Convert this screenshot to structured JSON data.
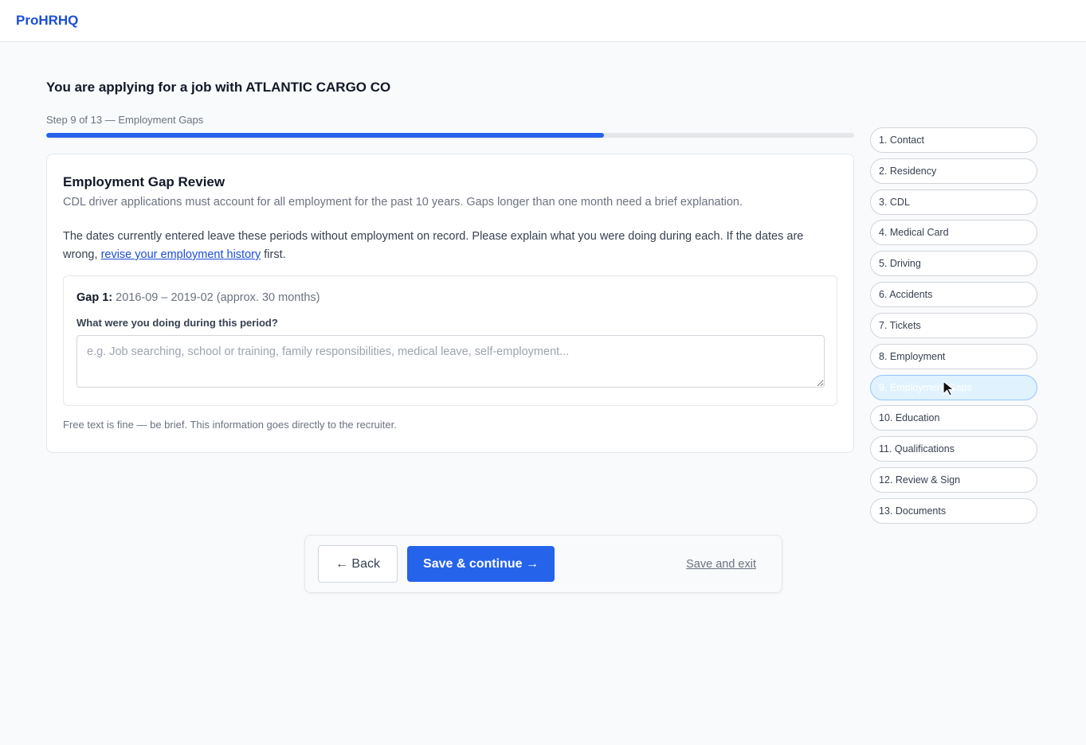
{
  "app": {
    "logo": "ProHRHQ"
  },
  "page": {
    "heading": "You are applying for a job with ATLANTIC CARGO CO",
    "step_label": "Step 9 of 13 — Employment Gaps",
    "progress_fraction": 0.69
  },
  "card": {
    "title": "Employment Gap Review",
    "subtitle": "CDL driver applications must account for all employment for the past 10 years. Gaps longer than one month need a brief explanation.",
    "body_before_link": "The dates currently entered leave these periods without employment on record. Please explain what you were doing during each. If the dates are wrong, ",
    "body_link": "revise your employment history",
    "body_after_link": " first.",
    "gap": {
      "label": "Gap 1:",
      "range": "2016-09 – 2019-02 (approx. 30 months)",
      "question": "What were you doing during this period?",
      "placeholder": "e.g. Job searching, school or training, family responsibilities, medical leave, self-employment...",
      "value": ""
    },
    "note": "Free text is fine — be brief. This information goes directly to the recruiter."
  },
  "steps": [
    {
      "label": "1. Contact"
    },
    {
      "label": "2. Residency"
    },
    {
      "label": "3. CDL"
    },
    {
      "label": "4. Medical Card"
    },
    {
      "label": "5. Driving"
    },
    {
      "label": "6. Accidents"
    },
    {
      "label": "7. Tickets"
    },
    {
      "label": "8. Employment"
    },
    {
      "label": "9. Employment Gaps",
      "active": true
    },
    {
      "label": "10. Education"
    },
    {
      "label": "11. Qualifications"
    },
    {
      "label": "12. Review & Sign"
    },
    {
      "label": "13. Documents"
    }
  ],
  "actions": {
    "back_label": "← Back",
    "save_label": "Save & continue →",
    "exit_label": "Save and exit"
  },
  "colors": {
    "accent": "#2563eb",
    "brand": "#1d4ed8",
    "active_step_bg": "#e0f2fe"
  }
}
